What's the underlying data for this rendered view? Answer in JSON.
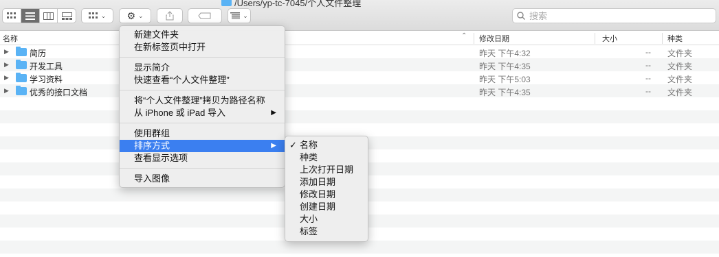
{
  "window": {
    "path_title": "/Users/yp-tc-7045/个人文件整理"
  },
  "toolbar": {
    "view_modes": [
      "icon-view",
      "list-view",
      "column-view",
      "gallery-view"
    ],
    "active_view": "list-view"
  },
  "search": {
    "placeholder": "搜索"
  },
  "columns": {
    "name": "名称",
    "modified": "修改日期",
    "size": "大小",
    "kind": "种类"
  },
  "files": [
    {
      "name": "简历",
      "date": "昨天 下午4:32",
      "size": "--",
      "kind": "文件夹"
    },
    {
      "name": "开发工具",
      "date": "昨天 下午4:35",
      "size": "--",
      "kind": "文件夹"
    },
    {
      "name": "学习资料",
      "date": "昨天 下午5:03",
      "size": "--",
      "kind": "文件夹"
    },
    {
      "name": "优秀的接口文档",
      "date": "昨天 下午4:35",
      "size": "--",
      "kind": "文件夹"
    }
  ],
  "action_menu": {
    "new_folder": "新建文件夹",
    "open_new_tab": "在新标签页中打开",
    "get_info": "显示简介",
    "quick_look": "快速查看“个人文件整理”",
    "copy_path": "将“个人文件整理”拷贝为路径名称",
    "import_from_iphone": "从 iPhone 或 iPad 导入",
    "use_groups": "使用群组",
    "sort_by": "排序方式",
    "show_view_options": "查看显示选项",
    "import_images": "导入图像"
  },
  "sort_menu": {
    "checked": "名称",
    "items": [
      "名称",
      "种类",
      "上次打开日期",
      "添加日期",
      "修改日期",
      "创建日期",
      "大小",
      "标签"
    ]
  },
  "colors": {
    "accent": "#3b7ff0",
    "folder": "#5ab3f5"
  }
}
